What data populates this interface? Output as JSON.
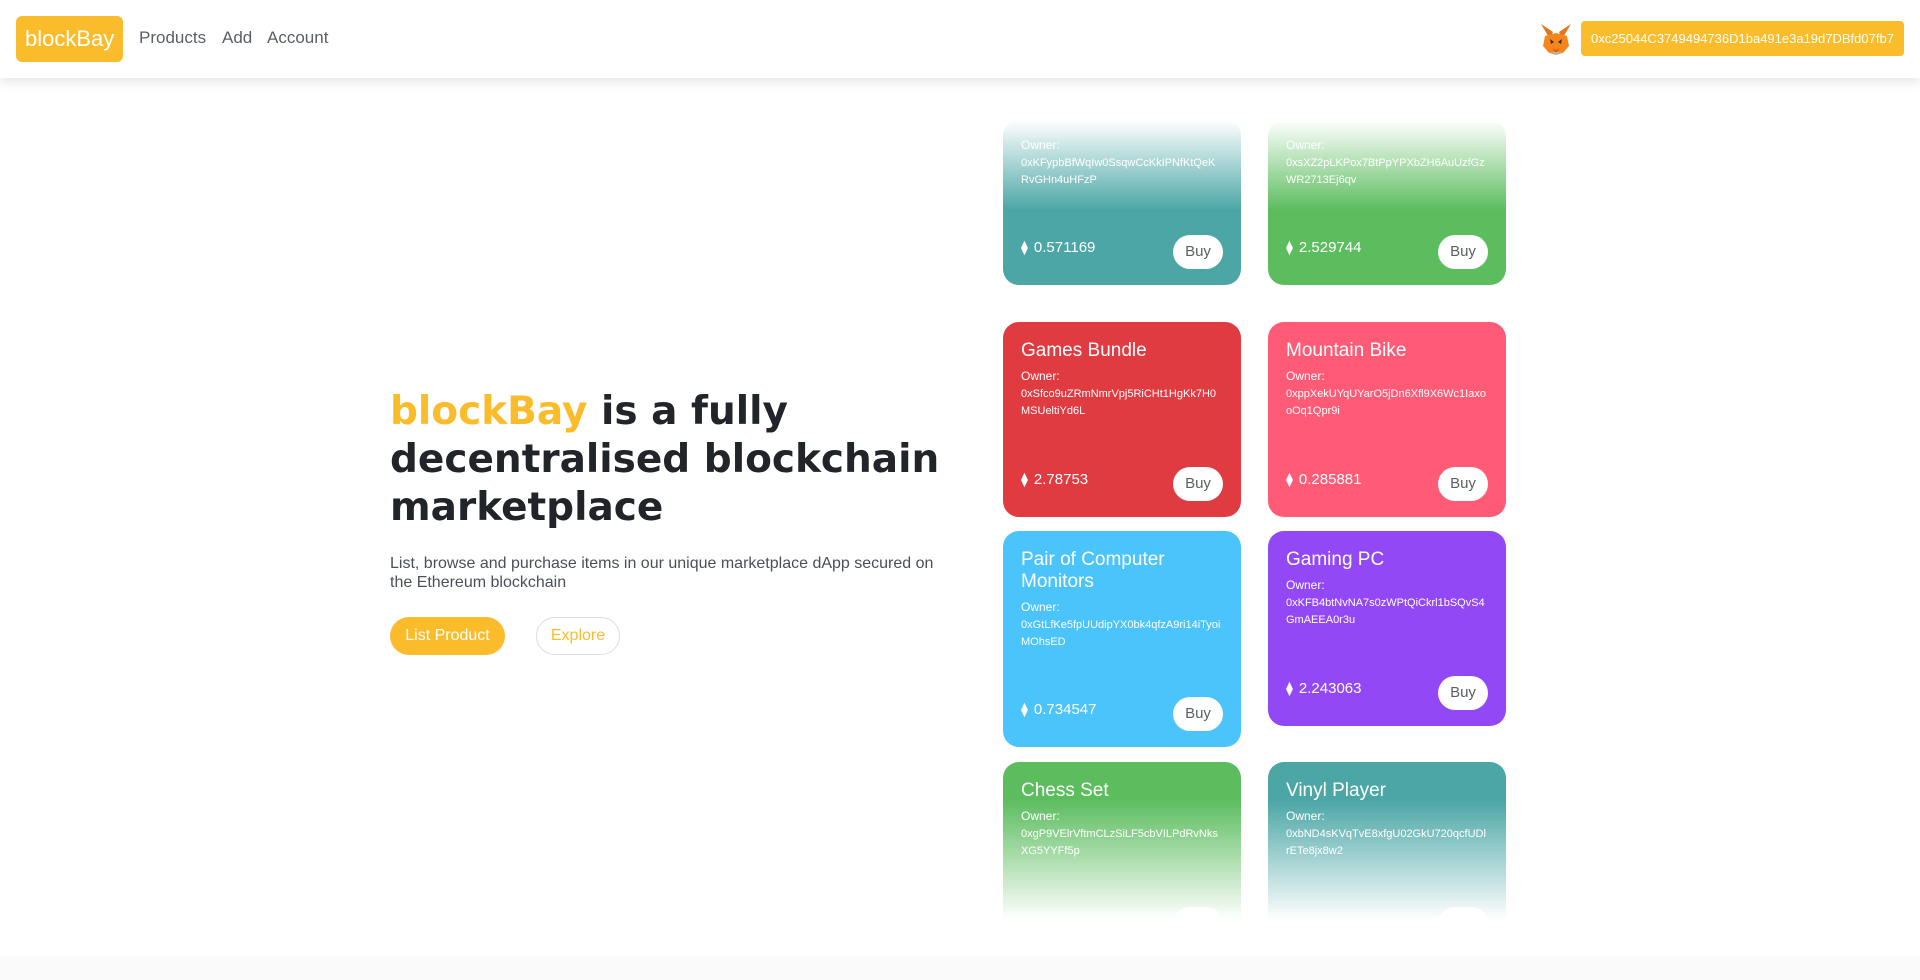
{
  "nav": {
    "brand": "blockBay",
    "links": [
      "Products",
      "Add",
      "Account"
    ],
    "wallet_address": "0xc25044C3749494736D1ba491e3a19d7DBfd07fb7"
  },
  "hero": {
    "title_accent": "blockBay",
    "title_rest": " is a fully decentralised blockchain marketplace",
    "description": "List, browse and purchase items in our unique marketplace dApp secured on the Ethereum blockchain",
    "primary_button": "List Product",
    "secondary_button": "Explore"
  },
  "card_common": {
    "owner_label": "Owner:",
    "buy_label": "Buy",
    "eth_symbol": "⧫"
  },
  "cards": [
    {
      "title": "",
      "owner": "0xKFypbBfWqIw0SsqwCcKkIPNfKtQeKRvGHn4uHFzP",
      "price": "0.571169"
    },
    {
      "title": "",
      "owner": "0xsXZ2pLKPox7BtPpYPXbZH6AuUzfGzWR2713Ej6qv",
      "price": "2.529744"
    },
    {
      "title": "Games Bundle",
      "owner": "0xSfco9uZRmNmrVpj5RiCHt1HgKk7H0MSUeltiYd6L",
      "price": "2.78753"
    },
    {
      "title": "Mountain Bike",
      "owner": "0xppXekUYqUYarO5jDn6Xfl9X6Wc1IaxooOq1Qpr9i",
      "price": "0.285881"
    },
    {
      "title": "Pair of Computer Monitors",
      "owner": "0xGtLfKe5fpUUdipYX0bk4qfzA9ri14iTyoiMOhsED",
      "price": "0.734547"
    },
    {
      "title": "Gaming PC",
      "owner": "0xKFB4btNvNA7s0zWPtQiCkrl1bSQvS4GmAEEA0r3u",
      "price": "2.243063"
    },
    {
      "title": "Chess Set",
      "owner": "0xgP9VElrVftmCLzSiLF5cbVILPdRvNksXG5YYFf5p",
      "price": ""
    },
    {
      "title": "Vinyl Player",
      "owner": "0xbND4sKVqTvE8xfgU02GkU720qcfUDlrETe8jx8w2",
      "price": ""
    }
  ]
}
